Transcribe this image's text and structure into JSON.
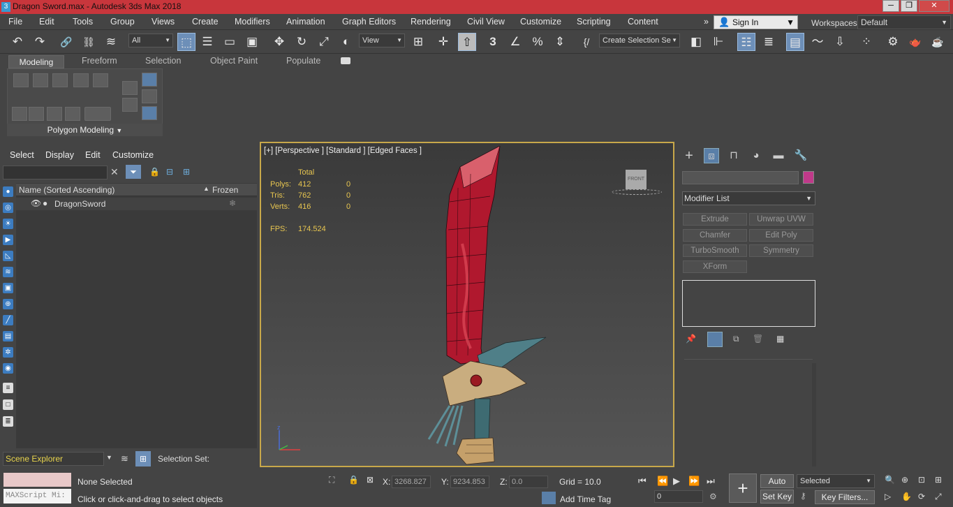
{
  "window": {
    "title": "Dragon Sword.max - Autodesk 3ds Max 2018",
    "app_icon_label": "3",
    "controls": [
      "─",
      "❐",
      "✕"
    ]
  },
  "menubar": {
    "items": [
      "File",
      "Edit",
      "Tools",
      "Group",
      "Views",
      "Create",
      "Modifiers",
      "Animation",
      "Graph Editors",
      "Rendering",
      "Civil View",
      "Customize",
      "Scripting",
      "Content"
    ],
    "overflow": "»",
    "signin": "Sign In",
    "workspaces_label": "Workspaces:",
    "workspace_value": "Default"
  },
  "toolbar": {
    "filter_select": "All",
    "reference_select": "View",
    "selection_set": "Create Selection Se",
    "icons": {
      "undo": "↶",
      "redo": "↷",
      "link": "🔗",
      "unlink": "⛓",
      "bind": "≋",
      "select": "⬚",
      "select_name": "☰",
      "rect_region": "▭",
      "window_crossing": "▣",
      "move": "✥",
      "rotate": "↻",
      "scale": "⤢",
      "placement": "◐",
      "pivot": "⊞",
      "manipulate": "✛",
      "keyboard": "⇧",
      "snap3": "3",
      "angle_snap": "∠",
      "percent_snap": "%",
      "spinner_snap": "⇕",
      "edit_named": "{/",
      "mirror": "◧",
      "align": "⊩",
      "layer_explorer": "☷",
      "toggle_ribbon": "≣",
      "scene_explorer": "▤",
      "curve_editor": "〜",
      "schematic": "⇩",
      "material": "⁘",
      "render_setup": "⚙",
      "render_frame": "🫖",
      "render": "☕"
    }
  },
  "ribbon": {
    "tabs": [
      "Modeling",
      "Freeform",
      "Selection",
      "Object Paint",
      "Populate"
    ],
    "panel_label": "Polygon Modeling"
  },
  "scene_explorer": {
    "menu": [
      "Select",
      "Display",
      "Edit",
      "Customize"
    ],
    "column_name": "Name (Sorted Ascending)",
    "column_frozen": "Frozen",
    "sort_arrow": "▲",
    "objects": [
      {
        "name": "DragonSword"
      }
    ],
    "explorer_name": "Scene Explorer",
    "selection_set_label": "Selection Set:"
  },
  "viewport": {
    "label": "[+] [Perspective ] [Standard ] [Edged Faces ]",
    "stats": {
      "total_label": "Total",
      "polys_label": "Polys:",
      "polys": "412",
      "polys_sel": "0",
      "tris_label": "Tris:",
      "tris": "762",
      "tris_sel": "0",
      "verts_label": "Verts:",
      "verts": "416",
      "verts_sel": "0",
      "fps_label": "FPS:",
      "fps": "174.524"
    },
    "viewcube_label": "FRONT",
    "axis_label_z": "z"
  },
  "command_panel": {
    "modifier_list": "Modifier List",
    "modifier_buttons": [
      "Extrude",
      "Unwrap UVW",
      "Chamfer",
      "Edit Poly",
      "TurboSmooth",
      "Symmetry",
      "XForm"
    ],
    "object_color": "#c03a8a"
  },
  "status": {
    "maxscript": "MAXScript Mi:",
    "none_selected": "None Selected",
    "prompt": "Click or click-and-drag to select objects",
    "x_label": "X:",
    "x_value": "3268.827",
    "y_label": "Y:",
    "y_value": "9234.853",
    "z_label": "Z:",
    "z_value": "0.0",
    "grid": "Grid = 10.0",
    "add_time_tag": "Add Time Tag",
    "auto_key": "Auto Key",
    "set_key": "Set Key",
    "key_mode": "Selected",
    "key_filters": "Key Filters...",
    "frame": "0"
  }
}
